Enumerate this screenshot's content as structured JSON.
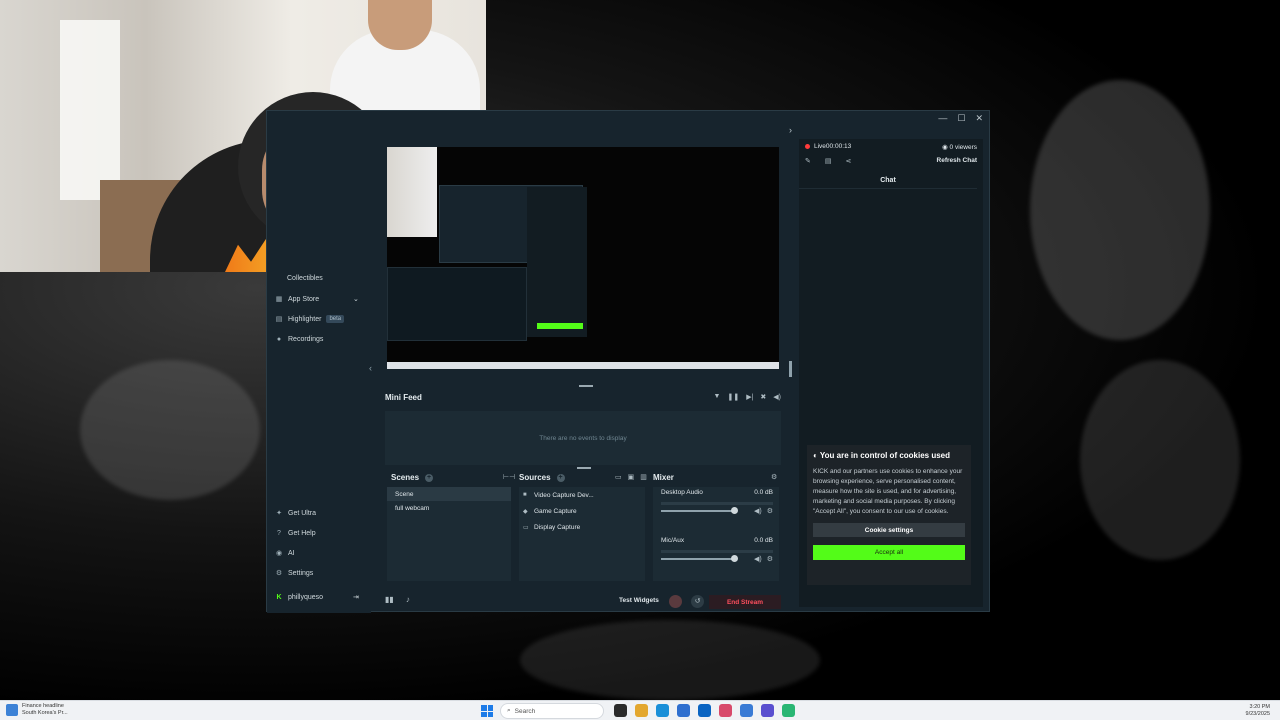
{
  "window": {
    "minimize": "—",
    "maximize": "☐",
    "close": "✕"
  },
  "sidebar": {
    "items": [
      {
        "label": "Collectibles",
        "icon": "collectibles-icon"
      },
      {
        "label": "App Store",
        "icon": "app-store-icon"
      },
      {
        "label": "Highlighter",
        "icon": "highlighter-icon",
        "badge": "beta"
      },
      {
        "label": "Recordings",
        "icon": "recordings-icon"
      }
    ],
    "bottom": [
      {
        "label": "Get Ultra",
        "icon": "ultra-icon"
      },
      {
        "label": "Get Help",
        "icon": "help-icon"
      },
      {
        "label": "AI",
        "icon": "ai-icon"
      },
      {
        "label": "Settings",
        "icon": "gear-icon"
      }
    ],
    "user": "phillyqueso",
    "expand_glyph": "⌄",
    "logout_glyph": "⇥",
    "collapse_glyph": "‹"
  },
  "minifeed": {
    "title": "Mini Feed",
    "empty": "There are no events to display"
  },
  "scenes": {
    "title": "Scenes",
    "items": [
      "Scene",
      "full webcam"
    ],
    "active_index": 0
  },
  "sources": {
    "title": "Sources",
    "items": [
      {
        "label": "Video Capture Dev...",
        "icon": "video-icon"
      },
      {
        "label": "Game Capture",
        "icon": "gamepad-icon"
      },
      {
        "label": "Display Capture",
        "icon": "monitor-icon"
      }
    ]
  },
  "mixer": {
    "title": "Mixer",
    "channels": [
      {
        "name": "Desktop Audio",
        "level": "0.0 dB",
        "volume": 1.0
      },
      {
        "name": "Mic/Aux",
        "level": "0.0 dB",
        "volume": 1.0
      }
    ]
  },
  "footer": {
    "test_widgets": "Test Widgets",
    "end_stream": "End Stream"
  },
  "chat": {
    "live": "Live00:00:13",
    "viewers": "0 viewers",
    "refresh": "Refresh Chat",
    "title": "Chat"
  },
  "cookie": {
    "title": "You are in control of cookies used",
    "body": "KICK and our partners use cookies to enhance your browsing experience, serve personalised content, measure how the site is used, and for advertising, marketing and social media purposes. By clicking \"Accept All\", you consent to our use of cookies.",
    "settings_button": "Cookie settings",
    "accept_button": "Accept all"
  },
  "taskbar": {
    "news_title": "Finance headline",
    "news_sub": "South Korea's Pr...",
    "search_placeholder": "Search",
    "time": "3:20 PM",
    "date": "9/23/2025"
  },
  "colors": {
    "app_bg": "#17242d",
    "accent_green": "#53fc18",
    "end_stream_red": "#ff4f5e",
    "live_dot": "#ff3b3b"
  }
}
